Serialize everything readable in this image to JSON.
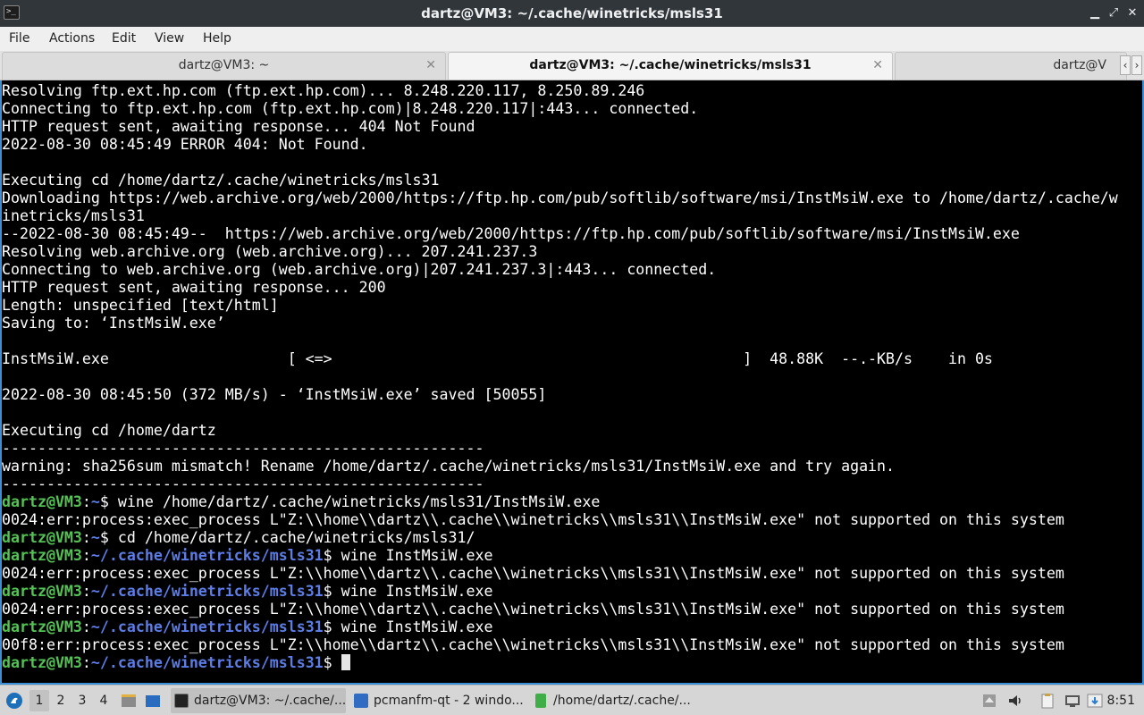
{
  "window": {
    "title": "dartz@VM3: ~/.cache/winetricks/msls31",
    "minimize": "▁",
    "maximize": "⤢",
    "close": "✕"
  },
  "menu": [
    "File",
    "Actions",
    "Edit",
    "View",
    "Help"
  ],
  "tabs": [
    {
      "label": "dartz@VM3: ~",
      "close": "✕"
    },
    {
      "label": "dartz@VM3: ~/.cache/winetricks/msls31",
      "close": "✕"
    },
    {
      "label": "dartz@V"
    }
  ],
  "tab_scroll": {
    "left": "‹",
    "right": "›"
  },
  "prompt": {
    "user": "dartz@VM3",
    "colon": ":",
    "dollar": "$ "
  },
  "terminal_lines": [
    {
      "kind": "text",
      "text": "Resolving ftp.ext.hp.com (ftp.ext.hp.com)... 8.248.220.117, 8.250.89.246"
    },
    {
      "kind": "text",
      "text": "Connecting to ftp.ext.hp.com (ftp.ext.hp.com)|8.248.220.117|:443... connected."
    },
    {
      "kind": "text",
      "text": "HTTP request sent, awaiting response... 404 Not Found"
    },
    {
      "kind": "text",
      "text": "2022-08-30 08:45:49 ERROR 404: Not Found."
    },
    {
      "kind": "text",
      "text": ""
    },
    {
      "kind": "text",
      "text": "Executing cd /home/dartz/.cache/winetricks/msls31"
    },
    {
      "kind": "text",
      "text": "Downloading https://web.archive.org/web/2000/https://ftp.hp.com/pub/softlib/software/msi/InstMsiW.exe to /home/dartz/.cache/w"
    },
    {
      "kind": "text",
      "text": "inetricks/msls31"
    },
    {
      "kind": "text",
      "text": "--2022-08-30 08:45:49--  https://web.archive.org/web/2000/https://ftp.hp.com/pub/softlib/software/msi/InstMsiW.exe"
    },
    {
      "kind": "text",
      "text": "Resolving web.archive.org (web.archive.org)... 207.241.237.3"
    },
    {
      "kind": "text",
      "text": "Connecting to web.archive.org (web.archive.org)|207.241.237.3|:443... connected."
    },
    {
      "kind": "text",
      "text": "HTTP request sent, awaiting response... 200"
    },
    {
      "kind": "text",
      "text": "Length: unspecified [text/html]"
    },
    {
      "kind": "text",
      "text": "Saving to: ‘InstMsiW.exe’"
    },
    {
      "kind": "text",
      "text": ""
    },
    {
      "kind": "text",
      "text": "InstMsiW.exe                    [ <=>                                              ]  48.88K  --.-KB/s    in 0s"
    },
    {
      "kind": "text",
      "text": ""
    },
    {
      "kind": "text",
      "text": "2022-08-30 08:45:50 (372 MB/s) - ‘InstMsiW.exe’ saved [50055]"
    },
    {
      "kind": "text",
      "text": ""
    },
    {
      "kind": "text",
      "text": "Executing cd /home/dartz"
    },
    {
      "kind": "text",
      "text": "------------------------------------------------------"
    },
    {
      "kind": "text",
      "text": "warning: sha256sum mismatch! Rename /home/dartz/.cache/winetricks/msls31/InstMsiW.exe and try again."
    },
    {
      "kind": "text",
      "text": "------------------------------------------------------"
    },
    {
      "kind": "prompt",
      "path": "~",
      "cmd": "wine /home/dartz/.cache/winetricks/msls31/InstMsiW.exe"
    },
    {
      "kind": "text",
      "text": "0024:err:process:exec_process L\"Z:\\\\home\\\\dartz\\\\.cache\\\\winetricks\\\\msls31\\\\InstMsiW.exe\" not supported on this system"
    },
    {
      "kind": "prompt",
      "path": "~",
      "cmd": "cd /home/dartz/.cache/winetricks/msls31/"
    },
    {
      "kind": "prompt",
      "path": "~/.cache/winetricks/msls31",
      "cmd": "wine InstMsiW.exe"
    },
    {
      "kind": "text",
      "text": "0024:err:process:exec_process L\"Z:\\\\home\\\\dartz\\\\.cache\\\\winetricks\\\\msls31\\\\InstMsiW.exe\" not supported on this system"
    },
    {
      "kind": "prompt",
      "path": "~/.cache/winetricks/msls31",
      "cmd": "wine InstMsiW.exe"
    },
    {
      "kind": "text",
      "text": "0024:err:process:exec_process L\"Z:\\\\home\\\\dartz\\\\.cache\\\\winetricks\\\\msls31\\\\InstMsiW.exe\" not supported on this system"
    },
    {
      "kind": "prompt",
      "path": "~/.cache/winetricks/msls31",
      "cmd": "wine InstMsiW.exe"
    },
    {
      "kind": "text",
      "text": "00f8:err:process:exec_process L\"Z:\\\\home\\\\dartz\\\\.cache\\\\winetricks\\\\msls31\\\\InstMsiW.exe\" not supported on this system"
    },
    {
      "kind": "prompt",
      "path": "~/.cache/winetricks/msls31",
      "cmd": "",
      "cursor": true
    }
  ],
  "taskbar": {
    "desktops": [
      "1",
      "2",
      "3",
      "4"
    ],
    "tasks": [
      {
        "label": "dartz@VM3: ~/.cache/...",
        "icon": "terminal-icon"
      },
      {
        "label": "pcmanfm-qt - 2 windo...",
        "icon": "folder-icon"
      },
      {
        "label": "/home/dartz/.cache/...",
        "icon": "archive-icon"
      }
    ],
    "clock": "8:51"
  },
  "colors": {
    "terminal_bg": "#000000",
    "prompt_user": "#54c254",
    "prompt_path": "#5c7ce6",
    "focus_border": "#3b8fd6"
  }
}
